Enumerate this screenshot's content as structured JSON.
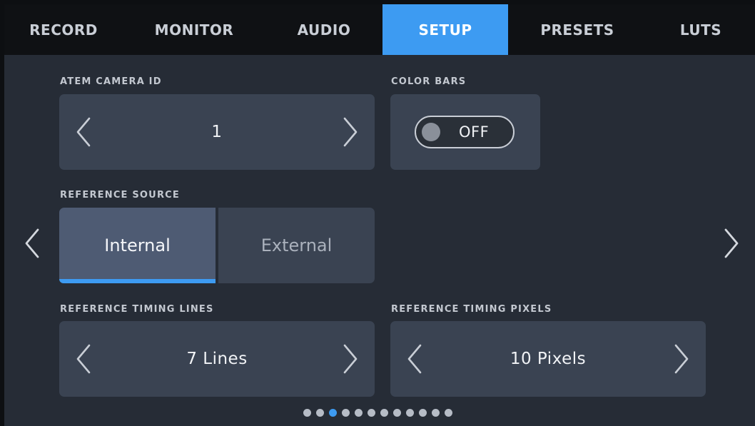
{
  "tabs": [
    {
      "label": "RECORD"
    },
    {
      "label": "MONITOR"
    },
    {
      "label": "AUDIO"
    },
    {
      "label": "SETUP",
      "active": true
    },
    {
      "label": "PRESETS"
    },
    {
      "label": "LUTS"
    }
  ],
  "atem_camera_id": {
    "label": "ATEM CAMERA ID",
    "value": "1"
  },
  "color_bars": {
    "label": "COLOR BARS",
    "state": "OFF"
  },
  "reference_source": {
    "label": "REFERENCE SOURCE",
    "options": [
      "Internal",
      "External"
    ],
    "selected": "Internal"
  },
  "reference_timing_lines": {
    "label": "REFERENCE TIMING LINES",
    "value": "7 Lines"
  },
  "reference_timing_pixels": {
    "label": "REFERENCE TIMING PIXELS",
    "value": "10 Pixels"
  },
  "pagination": {
    "total": 12,
    "current": 3
  },
  "colors": {
    "accent": "#3d9bf2",
    "panel": "#3a4352",
    "background": "#262c36",
    "tabbar": "#0f1114"
  },
  "icons": {
    "prev_value": "chevron-left-icon",
    "next_value": "chevron-right-icon",
    "prev_page": "chevron-left-icon",
    "next_page": "chevron-right-icon"
  }
}
